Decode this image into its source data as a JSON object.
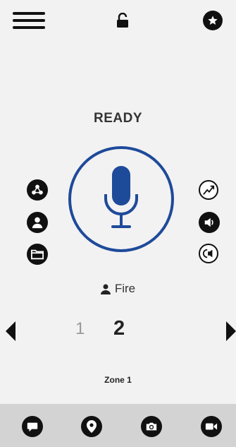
{
  "header": {
    "menu_icon": "hamburger-menu-icon",
    "lock_icon": "unlock-icon",
    "favorite_icon": "star-icon"
  },
  "status": {
    "text": "READY"
  },
  "ptt": {
    "icon": "microphone-icon",
    "ring_color": "#1e4a9a",
    "mic_color": "#1e4a9a"
  },
  "left_actions": [
    "map-icon",
    "contact-icon",
    "folder-icon"
  ],
  "right_actions": [
    "signal-icon",
    "volume-icon",
    "speaker-mode-icon"
  ],
  "talkgroup": {
    "icon": "person-icon",
    "name": "Fire"
  },
  "channel": {
    "previous": "1",
    "current": "2"
  },
  "zone": {
    "label": "Zone 1"
  },
  "bottom_nav": [
    "message-icon",
    "location-icon",
    "camera-icon",
    "video-icon"
  ]
}
